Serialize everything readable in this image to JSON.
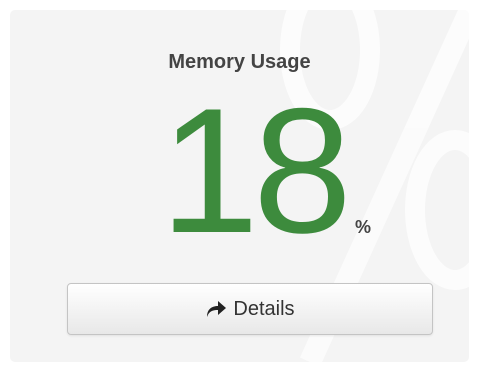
{
  "widget": {
    "title": "Memory Usage",
    "value": "18",
    "unit": "%",
    "button": {
      "label": "Details",
      "icon": "share-arrow-icon"
    }
  },
  "colors": {
    "value": "#3d8b3d",
    "tile_background": "#f4f4f4"
  }
}
